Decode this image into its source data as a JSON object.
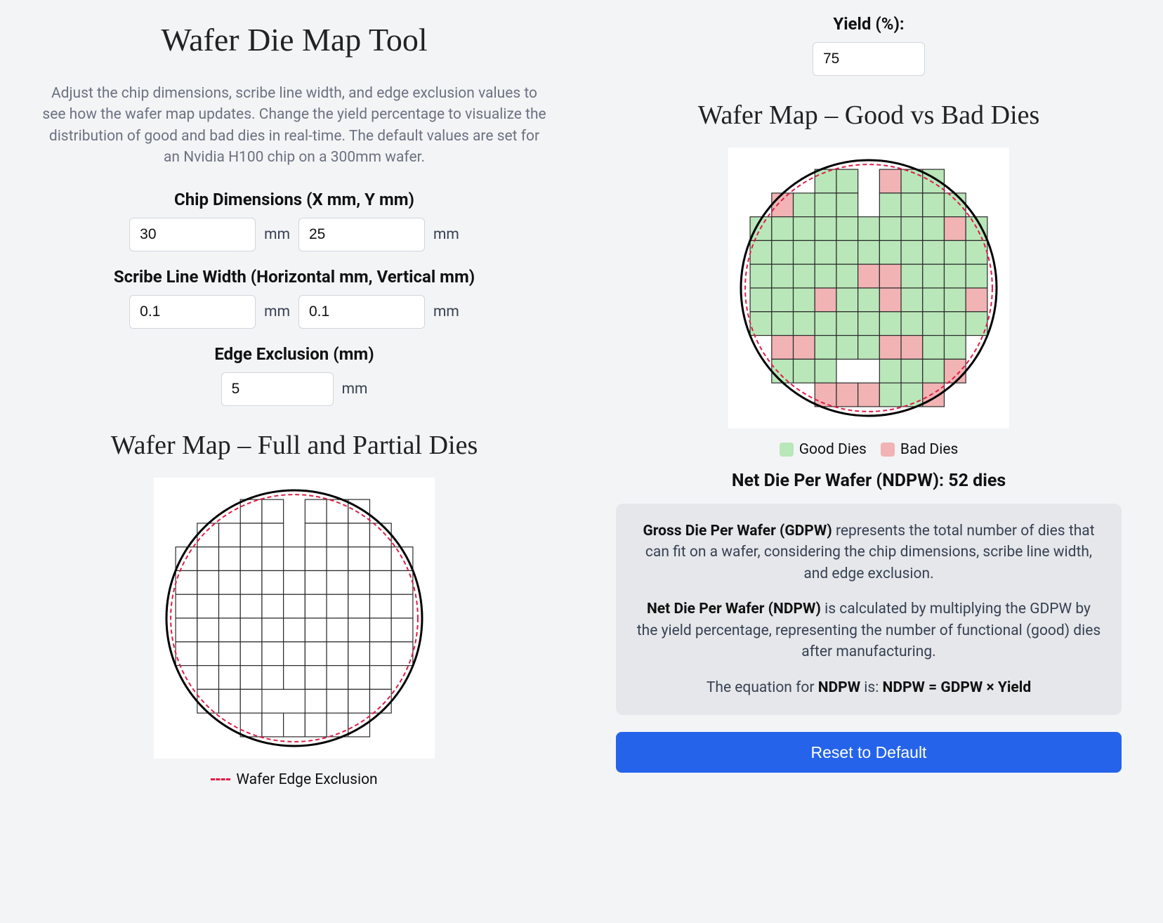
{
  "title": "Wafer Die Map Tool",
  "intro": "Adjust the chip dimensions, scribe line width, and edge exclusion values to see how the wafer map updates. Change the yield percentage to visualize the distribution of good and bad dies in real-time. The default values are set for an Nvidia H100 chip on a 300mm wafer.",
  "controls": {
    "chip_dims_label": "Chip Dimensions (X mm, Y mm)",
    "chip_x": "30",
    "chip_y": "25",
    "scribe_label": "Scribe Line Width (Horizontal mm, Vertical mm)",
    "scribe_h": "0.1",
    "scribe_v": "0.1",
    "edge_label": "Edge Exclusion (mm)",
    "edge_value": "5",
    "yield_label": "Yield (%):",
    "yield_value": "75",
    "unit_mm": "mm"
  },
  "sections": {
    "full_partial_title": "Wafer Map – Full and Partial Dies",
    "good_bad_title": "Wafer Map – Good vs Bad Dies"
  },
  "legend": {
    "edge_exclusion": "Wafer Edge Exclusion",
    "good": "Good Dies",
    "bad": "Bad Dies"
  },
  "ndpw_text": "Net Die Per Wafer (NDPW): 52 dies",
  "info": {
    "gdpw_strong": "Gross Die Per Wafer (GDPW)",
    "gdpw_rest": " represents the total number of dies that can fit on a wafer, considering the chip dimensions, scribe line width, and edge exclusion.",
    "ndpw_strong": "Net Die Per Wafer (NDPW)",
    "ndpw_rest": " is calculated by multiplying the GDPW by the yield percentage, representing the number of functional (good) dies after manufacturing.",
    "eq_pre": "The equation for ",
    "eq_mid": "NDPW",
    "eq_post": " is: ",
    "eq_formula": "NDPW = GDPW × Yield"
  },
  "reset_button": "Reset to Default",
  "colors": {
    "good": "#b9e7b9",
    "bad": "#f1b3b3",
    "grid": "#2b2b2b",
    "wafer_border": "#000000",
    "exclusion": "#e11d48",
    "accent": "#2563eb"
  },
  "chart_data": {
    "type": "other",
    "wafer_diameter_mm": 300,
    "edge_exclusion_mm": 5,
    "die_w_mm": 30,
    "die_h_mm": 25,
    "good_bad_rows": [
      "...GG.BGG..",
      ".BGGG.GGGG.",
      "GGGGGGGGGBG",
      "GGGGGGGGGGG",
      "GGGGGBBGGGG",
      "GGGBGGBGGGB",
      "GGGGGGGGGGG",
      ".BBGGGBBGG.",
      ".GGG..GGGB.",
      "...BBBGGB.."
    ],
    "legend": {
      "G": "Good Dies",
      "B": "Bad Dies",
      ".": "empty"
    },
    "ndpw": 52
  }
}
